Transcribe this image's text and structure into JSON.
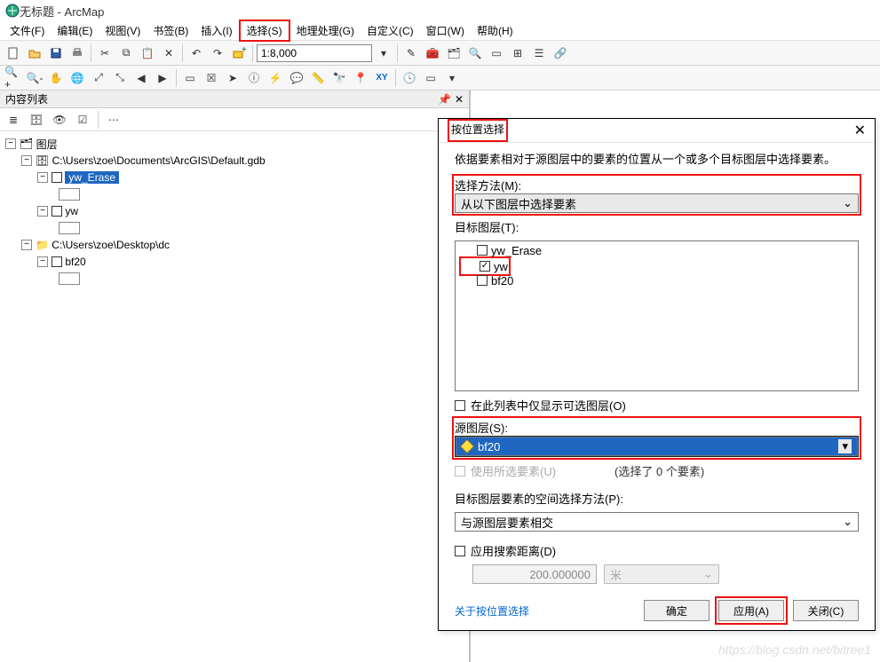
{
  "title": "无标题 - ArcMap",
  "menu": {
    "file": "文件(F)",
    "edit": "编辑(E)",
    "view": "视图(V)",
    "bookmark": "书签(B)",
    "insert": "插入(I)",
    "select": "选择(S)",
    "geoproc": "地理处理(G)",
    "customize": "自定义(C)",
    "window": "窗口(W)",
    "help": "帮助(H)"
  },
  "scale": "1:8,000",
  "toc": {
    "title": "内容列表",
    "root": "图层",
    "gdb_path": "C:\\Users\\zoe\\Documents\\ArcGIS\\Default.gdb",
    "layer1": "yw_Erase",
    "layer2": "yw",
    "dc_path": "C:\\Users\\zoe\\Desktop\\dc",
    "layer3": "bf20"
  },
  "dialog": {
    "title": "按位置选择",
    "desc": "依据要素相对于源图层中的要素的位置从一个或多个目标图层中选择要素。",
    "method_label": "选择方法(M):",
    "method_value": "从以下图层中选择要素",
    "target_label": "目标图层(T):",
    "targets": [
      {
        "name": "yw_Erase",
        "checked": false
      },
      {
        "name": "yw",
        "checked": true
      },
      {
        "name": "bf20",
        "checked": false
      }
    ],
    "only_visible_label": "在此列表中仅显示可选图层(O)",
    "source_label": "源图层(S):",
    "source_value": "bf20",
    "use_selected_label": "使用所选要素(U)",
    "selected_count": "(选择了 0 个要素)",
    "spatial_method_label": "目标图层要素的空间选择方法(P):",
    "spatial_method_value": "与源图层要素相交",
    "apply_dist_label": "应用搜索距离(D)",
    "dist_value": "200.000000",
    "unit_value": "米",
    "help_link": "关于按位置选择",
    "ok": "确定",
    "apply": "应用(A)",
    "close": "关闭(C)"
  },
  "watermark": "https://blog.csdn.net/bitree1"
}
